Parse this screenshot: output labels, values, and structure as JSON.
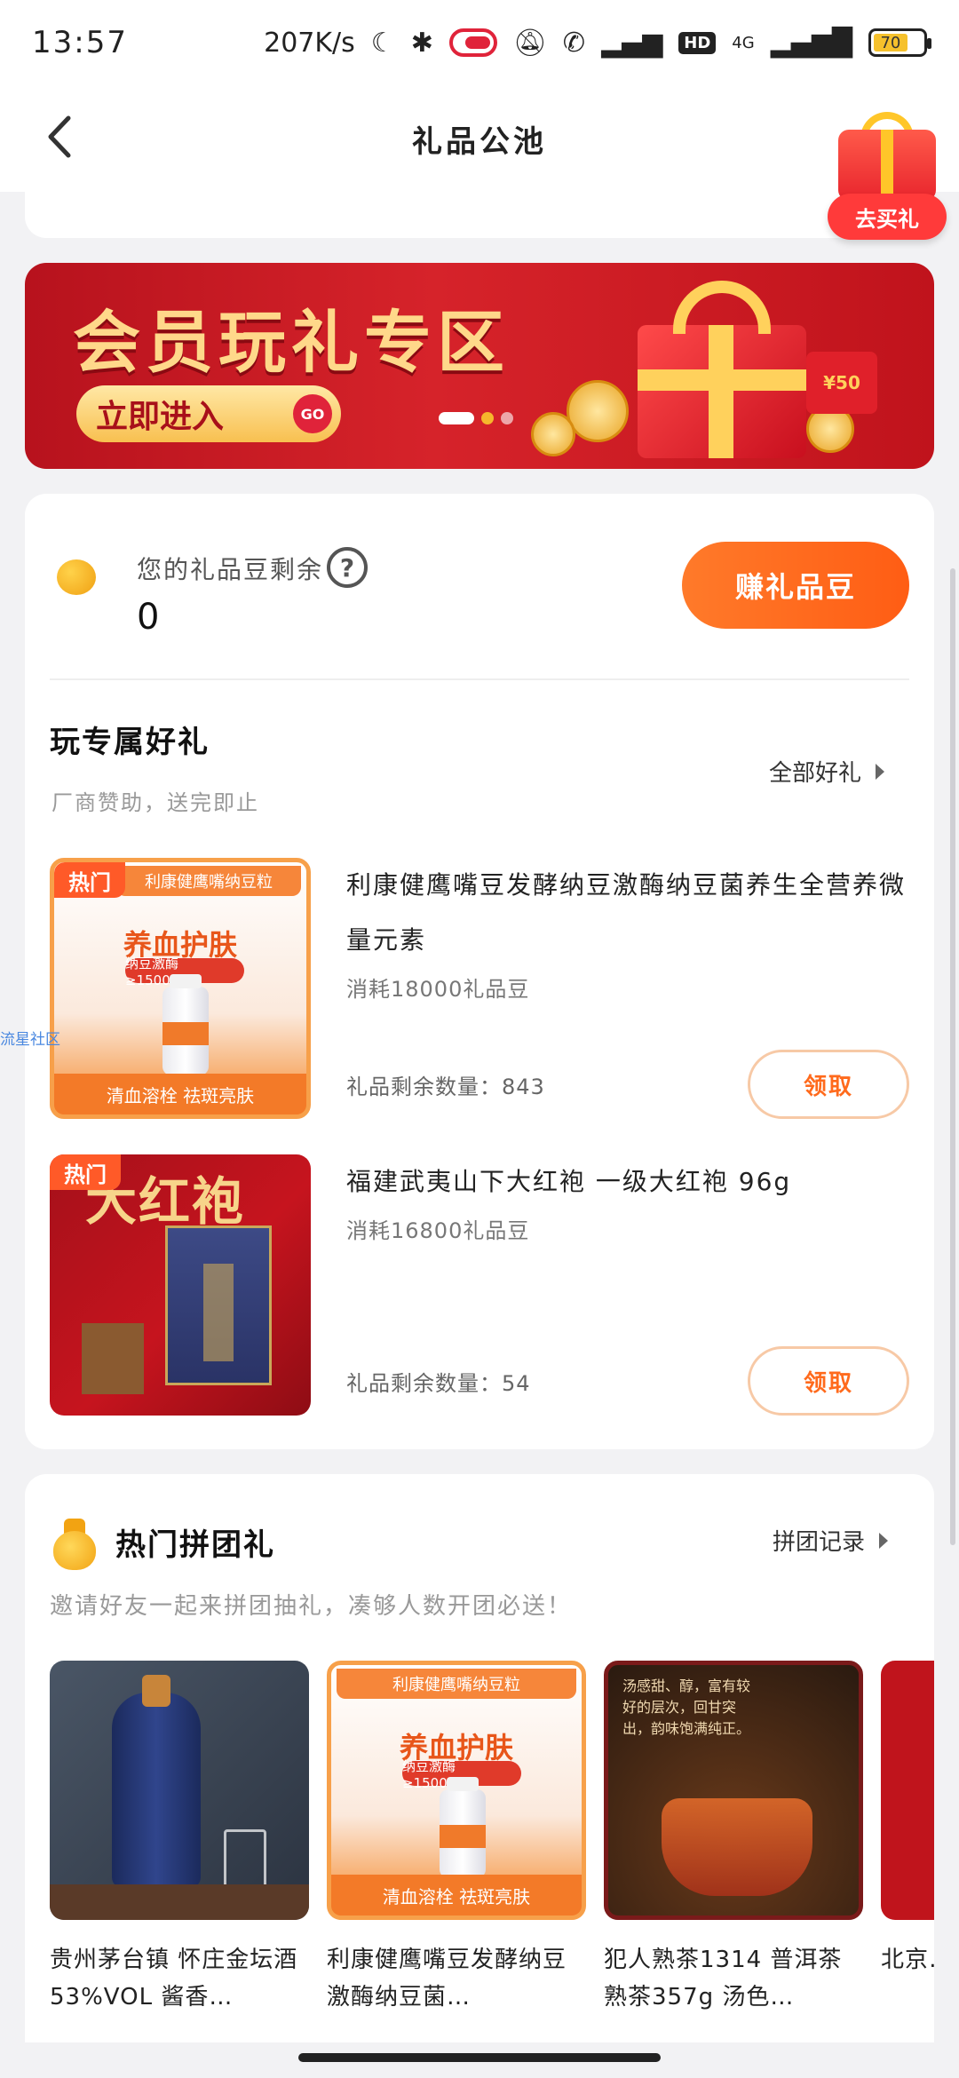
{
  "status_bar": {
    "time": "13:57",
    "net_speed": "207K/s",
    "battery": "70",
    "hd": "HD",
    "network": "4G",
    "icons": [
      "moon-icon",
      "bluetooth-icon",
      "toggle-icon",
      "mute-icon",
      "call-icon",
      "signal-icon",
      "battery-icon"
    ]
  },
  "nav": {
    "title": "礼品公池",
    "back_icon": "back-arrow-icon"
  },
  "float_gift": {
    "label": "去买礼"
  },
  "banner": {
    "title": "会员玩礼专区",
    "button": "立即进入",
    "go": "GO",
    "envelope": "¥50"
  },
  "balance": {
    "label": "您的礼品豆剩余",
    "value": "0",
    "help": "?",
    "earn_button": "赚礼品豆"
  },
  "exclusive": {
    "title": "玩专属好礼",
    "subtitle": "厂商赞助，送完即止",
    "all_link": "全部好礼",
    "items": [
      {
        "tag": "热门",
        "image_strip": "利康健鹰嘴纳豆粒",
        "image_headline": "养血护肤",
        "image_pill": "纳豆激酶≥15000U/g",
        "image_bottom": "清血溶栓 祛斑亮肤",
        "name": "利康健鹰嘴豆发酵纳豆激酶纳豆菌养生全营养微量元素",
        "cost": "消耗18000礼品豆",
        "stock": "礼品剩余数量：843",
        "button": "领取"
      },
      {
        "tag": "热门",
        "image_title": "大红袍",
        "name": "福建武夷山下大红袍 一级大红袍 96g",
        "cost": "消耗16800礼品豆",
        "stock": "礼品剩余数量：54",
        "button": "领取"
      }
    ]
  },
  "watermark": "流星社区",
  "group": {
    "title": "热门拼团礼",
    "link": "拼团记录",
    "subtitle": "邀请好友一起来拼团抽礼，凑够人数开团必送！",
    "products": [
      {
        "name": "贵州茅台镇 怀庄金坛酒53%VOL 酱香…"
      },
      {
        "name": "利康健鹰嘴豆发酵纳豆激酶纳豆菌…",
        "image_strip": "利康健鹰嘴纳豆粒",
        "image_headline": "养血护肤",
        "image_pill": "纳豆激酶≥15000U/g",
        "image_bottom": "清血溶栓 祛斑亮肤"
      },
      {
        "name": "犯人熟茶1314 普洱茶熟茶357g 汤色…",
        "image_text": "汤感甜、醇，富有较好的层次，回甘突出，韵味饱满纯正。"
      },
      {
        "name": "北京…"
      }
    ]
  }
}
